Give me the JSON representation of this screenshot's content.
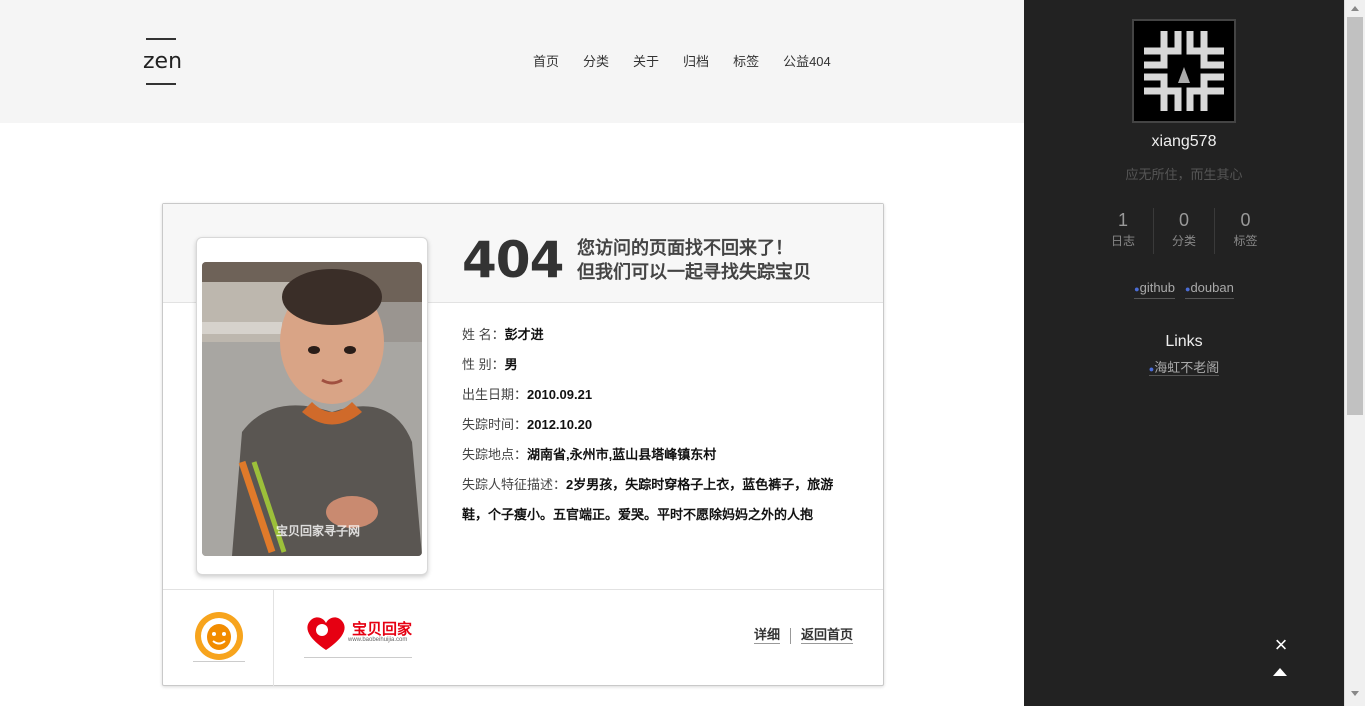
{
  "header": {
    "logo": "zen",
    "nav": [
      "首页",
      "分类",
      "关于",
      "归档",
      "标签",
      "公益404"
    ]
  },
  "card": {
    "code": "404",
    "message_line1": "您访问的页面找不回来了！",
    "message_line2": "但我们可以一起寻找失踪宝贝",
    "photo_watermark": "宝贝回家寻子网",
    "fields": [
      {
        "label": "姓 名：",
        "value": "彭才进"
      },
      {
        "label": "性 别：",
        "value": "男"
      },
      {
        "label": "出生日期：",
        "value": "2010.09.21"
      },
      {
        "label": "失踪时间：",
        "value": "2012.10.20"
      },
      {
        "label": "失踪地点：",
        "value": "湖南省,永州市,蓝山县塔峰镇东村"
      },
      {
        "label": "失踪人特征描述：",
        "value": "2岁男孩，失踪时穿格子上衣，蓝色裤子，旅游鞋，个子瘦小。五官端正。爱哭。平时不愿除妈妈之外的人抱"
      }
    ],
    "footer": {
      "qq_logo_text": "腾讯志愿者",
      "bbhj_logo_text": "宝贝回家",
      "bbhj_logo_url": "www.baobeihuijia.com",
      "detail_link": "详细",
      "home_link": "返回首页"
    }
  },
  "sidebar": {
    "username": "xiang578",
    "motto": "应无所住，而生其心",
    "stats": [
      {
        "num": "1",
        "label": "日志"
      },
      {
        "num": "0",
        "label": "分类"
      },
      {
        "num": "0",
        "label": "标签"
      }
    ],
    "social": [
      "github",
      "douban"
    ],
    "links_title": "Links",
    "links": [
      "海虹不老阁"
    ],
    "close_symbol": "×"
  },
  "colors": {
    "sidebar_bg": "#222222",
    "header_bg": "#f5f5f5",
    "accent_dot": "#4b6dd6",
    "logo_red": "#e60012"
  }
}
